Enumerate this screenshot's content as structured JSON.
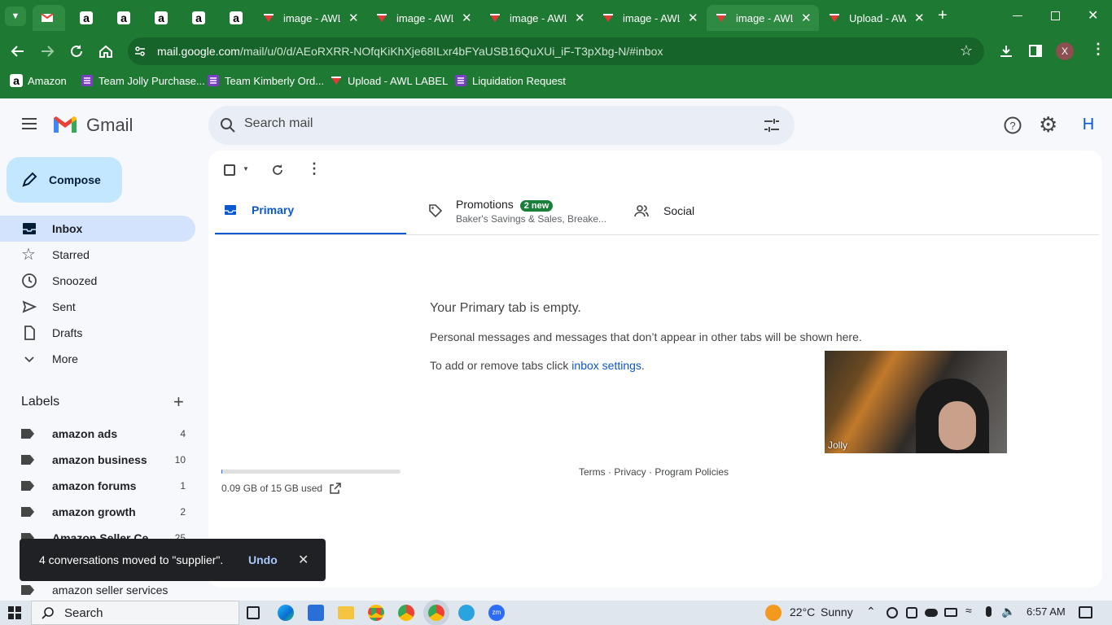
{
  "browser": {
    "tabs": [
      {
        "title": "",
        "favicon": "gmail-icon",
        "active": false
      },
      {
        "title": "",
        "favicon": "amazon-icon",
        "active": false
      },
      {
        "title": "",
        "favicon": "amazon-icon",
        "active": false
      },
      {
        "title": "",
        "favicon": "amazon-icon",
        "active": false
      },
      {
        "title": "",
        "favicon": "amazon-icon",
        "active": false
      },
      {
        "title": "",
        "favicon": "amazon-icon",
        "active": false
      },
      {
        "title": "image - AWL",
        "favicon": "awl-icon",
        "active": false
      },
      {
        "title": "image - AWL",
        "favicon": "awl-icon",
        "active": false
      },
      {
        "title": "image - AWL",
        "favicon": "awl-icon",
        "active": false
      },
      {
        "title": "image - AWL",
        "favicon": "awl-icon",
        "active": false
      },
      {
        "title": "image - AWL",
        "favicon": "awl-icon",
        "active": true
      },
      {
        "title": "Upload - AWL",
        "favicon": "awl-icon",
        "active": false
      }
    ],
    "url_host": "mail.google.com",
    "url_path": "/mail/u/0/d/AEoRXRR-NOfqKiKhXje68ILxr4bFYaUSB16QuXUi_iF-T3pXbg-N/#inbox",
    "profile_initial": "X",
    "bookmarks": [
      "Amazon",
      "Team Jolly Purchase...",
      "Team Kimberly Ord...",
      "Upload - AWL LABEL",
      "Liquidation Request"
    ],
    "theme_color": "#1e7a32"
  },
  "gmail": {
    "logo_text": "Gmail",
    "search_placeholder": "Search mail",
    "account_initial": "H",
    "compose_label": "Compose",
    "nav": [
      {
        "label": "Inbox",
        "icon": "inbox-icon",
        "active": true
      },
      {
        "label": "Starred",
        "icon": "star-icon",
        "active": false
      },
      {
        "label": "Snoozed",
        "icon": "clock-icon",
        "active": false
      },
      {
        "label": "Sent",
        "icon": "send-icon",
        "active": false
      },
      {
        "label": "Drafts",
        "icon": "draft-icon",
        "active": false
      },
      {
        "label": "More",
        "icon": "chevron-down-icon",
        "active": false
      }
    ],
    "labels_title": "Labels",
    "labels": [
      {
        "name": "amazon ads",
        "count": "4"
      },
      {
        "name": "amazon business",
        "count": "10"
      },
      {
        "name": "amazon forums",
        "count": "1"
      },
      {
        "name": "amazon growth",
        "count": "2"
      },
      {
        "name": "Amazon Seller Ce...",
        "count": "25"
      },
      {
        "name": "",
        "count": ""
      },
      {
        "name": "amazon seller services",
        "count": ""
      }
    ],
    "tabs": {
      "primary": "Primary",
      "promotions": "Promotions",
      "promotions_badge": "2 new",
      "promotions_snippet": "Baker's Savings & Sales, Breake...",
      "social": "Social"
    },
    "empty": {
      "title": "Your Primary tab is empty.",
      "line1": "Personal messages and messages that don’t appear in other tabs will be shown here.",
      "line2_prefix": "To add or remove tabs click ",
      "line2_link": "inbox settings",
      "line2_suffix": "."
    },
    "storage": {
      "text": "0.09 GB of 15 GB used",
      "used_fraction": 0.006
    },
    "footer": {
      "terms": "Terms",
      "privacy": "Privacy",
      "policies": "Program Policies",
      "sep": " · "
    },
    "toast": {
      "message": "4 conversations moved to \"supplier\".",
      "undo": "Undo"
    }
  },
  "video_overlay": {
    "participant": "Jolly"
  },
  "taskbar": {
    "search": "Search",
    "weather": "22°C",
    "weather_desc": "Sunny",
    "time": "6:57 AM"
  }
}
